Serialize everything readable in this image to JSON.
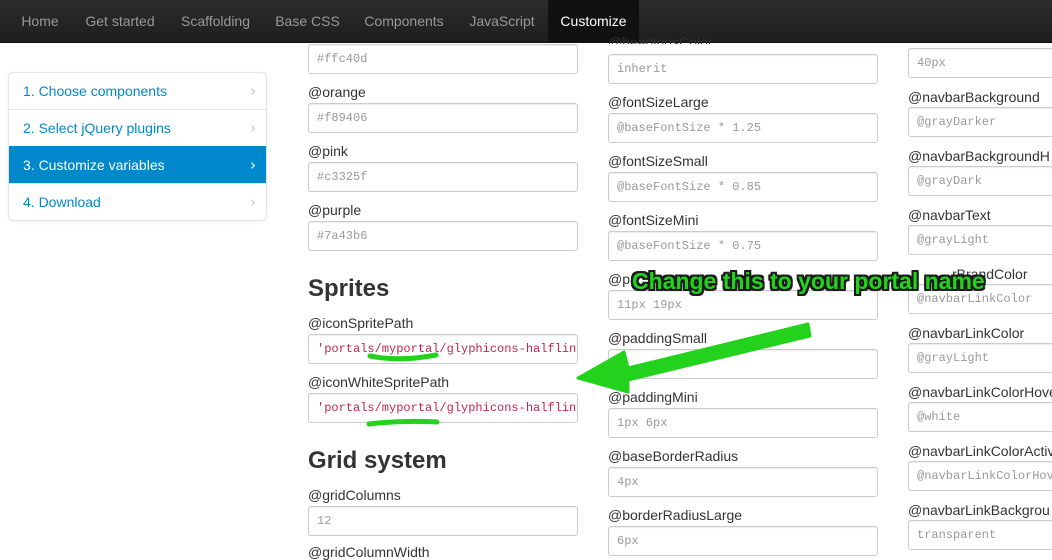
{
  "navbar": {
    "items": [
      {
        "label": "Home"
      },
      {
        "label": "Get started"
      },
      {
        "label": "Scaffolding"
      },
      {
        "label": "Base CSS"
      },
      {
        "label": "Components"
      },
      {
        "label": "JavaScript"
      },
      {
        "label": "Customize"
      }
    ],
    "active": "Customize"
  },
  "sidebar": {
    "items": [
      {
        "label": "1. Choose components"
      },
      {
        "label": "2. Select jQuery plugins"
      },
      {
        "label": "3. Customize variables"
      },
      {
        "label": "4. Download"
      }
    ],
    "chevron_icon": "chevron-right-icon"
  },
  "col1": {
    "yellow_value": "#ffc40d",
    "orange_label": "@orange",
    "orange_value": "#f89406",
    "pink_label": "@pink",
    "pink_value": "#c3325f",
    "purple_label": "@purple",
    "purple_value": "#7a43b6",
    "sprites_title": "Sprites",
    "icon_sprite_label": "@iconSpritePath",
    "icon_sprite_value": "'portals/myportal/glyphicons-halflings.png'",
    "icon_white_label": "@iconWhiteSpritePath",
    "icon_white_value": "'portals/myportal/glyphicons-halflings-white.png'",
    "grid_title": "Grid system",
    "grid_columns_label": "@gridColumns",
    "grid_columns_value": "12",
    "grid_column_width_label": "@gridColumnWidth"
  },
  "col2": {
    "headings_color_label": "@headingsColor",
    "headings_color_value": "inherit",
    "font_large_label": "@fontSizeLarge",
    "font_large_value": "@baseFontSize * 1.25",
    "font_small_label": "@fontSizeSmall",
    "font_small_value": "@baseFontSize * 0.85",
    "font_mini_label": "@fontSizeMini",
    "font_mini_value": "@baseFontSize * 0.75",
    "padding_large_label": "@pa",
    "padding_large_value": "11px 19px",
    "padding_small_label": "@paddingSmall",
    "padding_small_value": "px",
    "padding_mini_label": "@paddingMini",
    "padding_mini_value": "1px 6px",
    "base_radius_label": "@baseBorderRadius",
    "base_radius_value": "4px",
    "radius_large_label": "@borderRadiusLarge",
    "radius_large_value": "6px"
  },
  "col3": {
    "top_value": "40px",
    "navbar_bg_label": "@navbarBackground",
    "navbar_bg_value": "@grayDarker",
    "navbar_bg_h_label": "@navbarBackgroundH",
    "navbar_bg_h_value": "@grayDark",
    "navbar_text_label": "@navbarText",
    "navbar_text_value": "@grayLight",
    "navbar_brand_label": "rBrandColor",
    "navbar_brand_value": "@navbarLinkColor",
    "navbar_link_label": "@navbarLinkColor",
    "navbar_link_value": "@grayLight",
    "navbar_link_hover_label": "@navbarLinkColorHove",
    "navbar_link_hover_value": "@white",
    "navbar_link_active_label": "@navbarLinkColorActiv",
    "navbar_link_active_value": "@navbarLinkColorHove",
    "navbar_link_bg_label": "@navbarLinkBackgrou",
    "navbar_link_bg_value": "transparent"
  },
  "annotation": {
    "text": "Change this to your portal name",
    "color": "#22d21c",
    "arrow_icon": "arrow-left-icon",
    "underline_icon": "underline-highlight-icon"
  },
  "colors": {
    "navbar_bg": "#1e1e1e",
    "active_sidebar": "#0088cc",
    "link": "#0088cc",
    "code_text": "#c7254e"
  }
}
